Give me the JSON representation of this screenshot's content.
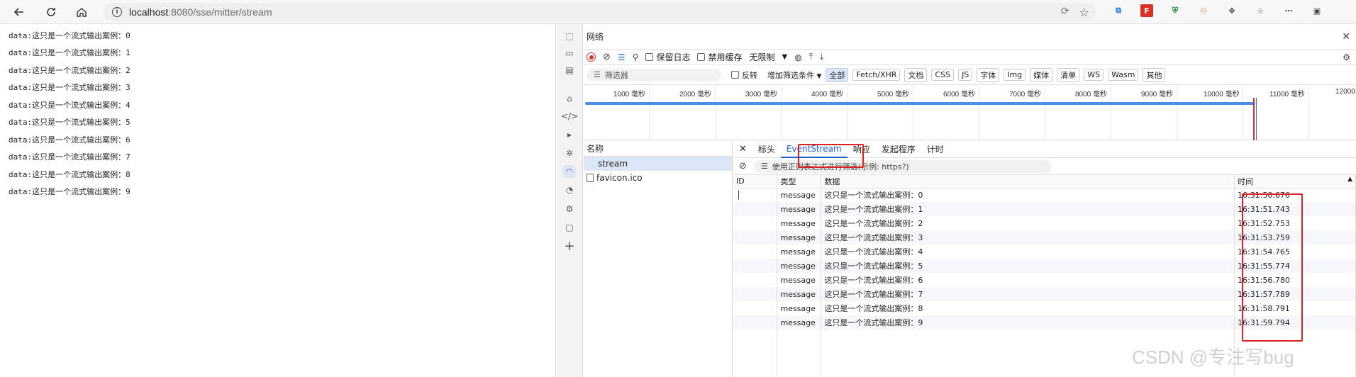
{
  "browser": {
    "url_host": "localhost",
    "url_path": ":8080/sse/mitter/stream"
  },
  "page": {
    "lines": [
      "data:这只是一个流式输出案例：0",
      "data:这只是一个流式输出案例：1",
      "data:这只是一个流式输出案例：2",
      "data:这只是一个流式输出案例：3",
      "data:这只是一个流式输出案例：4",
      "data:这只是一个流式输出案例：5",
      "data:这只是一个流式输出案例：6",
      "data:这只是一个流式输出案例：7",
      "data:这只是一个流式输出案例：8",
      "data:这只是一个流式输出案例：9"
    ]
  },
  "devtools": {
    "title": "网络",
    "toolbar": {
      "preserve_log": "保留日志",
      "disable_cache": "禁用缓存",
      "throttle": "无限制"
    },
    "filter": {
      "placeholder": "筛选器",
      "invert": "反转",
      "more_filters": "增加筛选条件",
      "types": [
        "全部",
        "Fetch/XHR",
        "文档",
        "CSS",
        "JS",
        "字体",
        "Img",
        "媒体",
        "清单",
        "WS",
        "Wasm",
        "其他"
      ]
    },
    "timeline_ticks": [
      "1000 毫秒",
      "2000 毫秒",
      "3000 毫秒",
      "4000 毫秒",
      "5000 毫秒",
      "6000 毫秒",
      "7000 毫秒",
      "8000 毫秒",
      "9000 毫秒",
      "10000 毫秒",
      "11000 毫秒",
      "12000"
    ],
    "names_header": "名称",
    "requests": [
      "stream",
      "favicon.ico"
    ],
    "detail_tabs": [
      "标头",
      "EventStream",
      "响应",
      "发起程序",
      "计时"
    ],
    "es_filter_placeholder": "使用正则表达式进行筛选(示例: https?)",
    "es_columns": [
      "ID",
      "类型",
      "数据",
      "时间"
    ],
    "es_rows": [
      {
        "type": "message",
        "data": "这只是一个流式输出案例：0",
        "time": "16:31:50.676"
      },
      {
        "type": "message",
        "data": "这只是一个流式输出案例：1",
        "time": "16:31:51.743"
      },
      {
        "type": "message",
        "data": "这只是一个流式输出案例：2",
        "time": "16:31:52.753"
      },
      {
        "type": "message",
        "data": "这只是一个流式输出案例：3",
        "time": "16:31:53.759"
      },
      {
        "type": "message",
        "data": "这只是一个流式输出案例：4",
        "time": "16:31:54.765"
      },
      {
        "type": "message",
        "data": "这只是一个流式输出案例：5",
        "time": "16:31:55.774"
      },
      {
        "type": "message",
        "data": "这只是一个流式输出案例：6",
        "time": "16:31:56.780"
      },
      {
        "type": "message",
        "data": "这只是一个流式输出案例：7",
        "time": "16:31:57.789"
      },
      {
        "type": "message",
        "data": "这只是一个流式输出案例：8",
        "time": "16:31:58.791"
      },
      {
        "type": "message",
        "data": "这只是一个流式输出案例：9",
        "time": "16:31:59.794"
      }
    ]
  },
  "watermark": "CSDN @专注写bug"
}
